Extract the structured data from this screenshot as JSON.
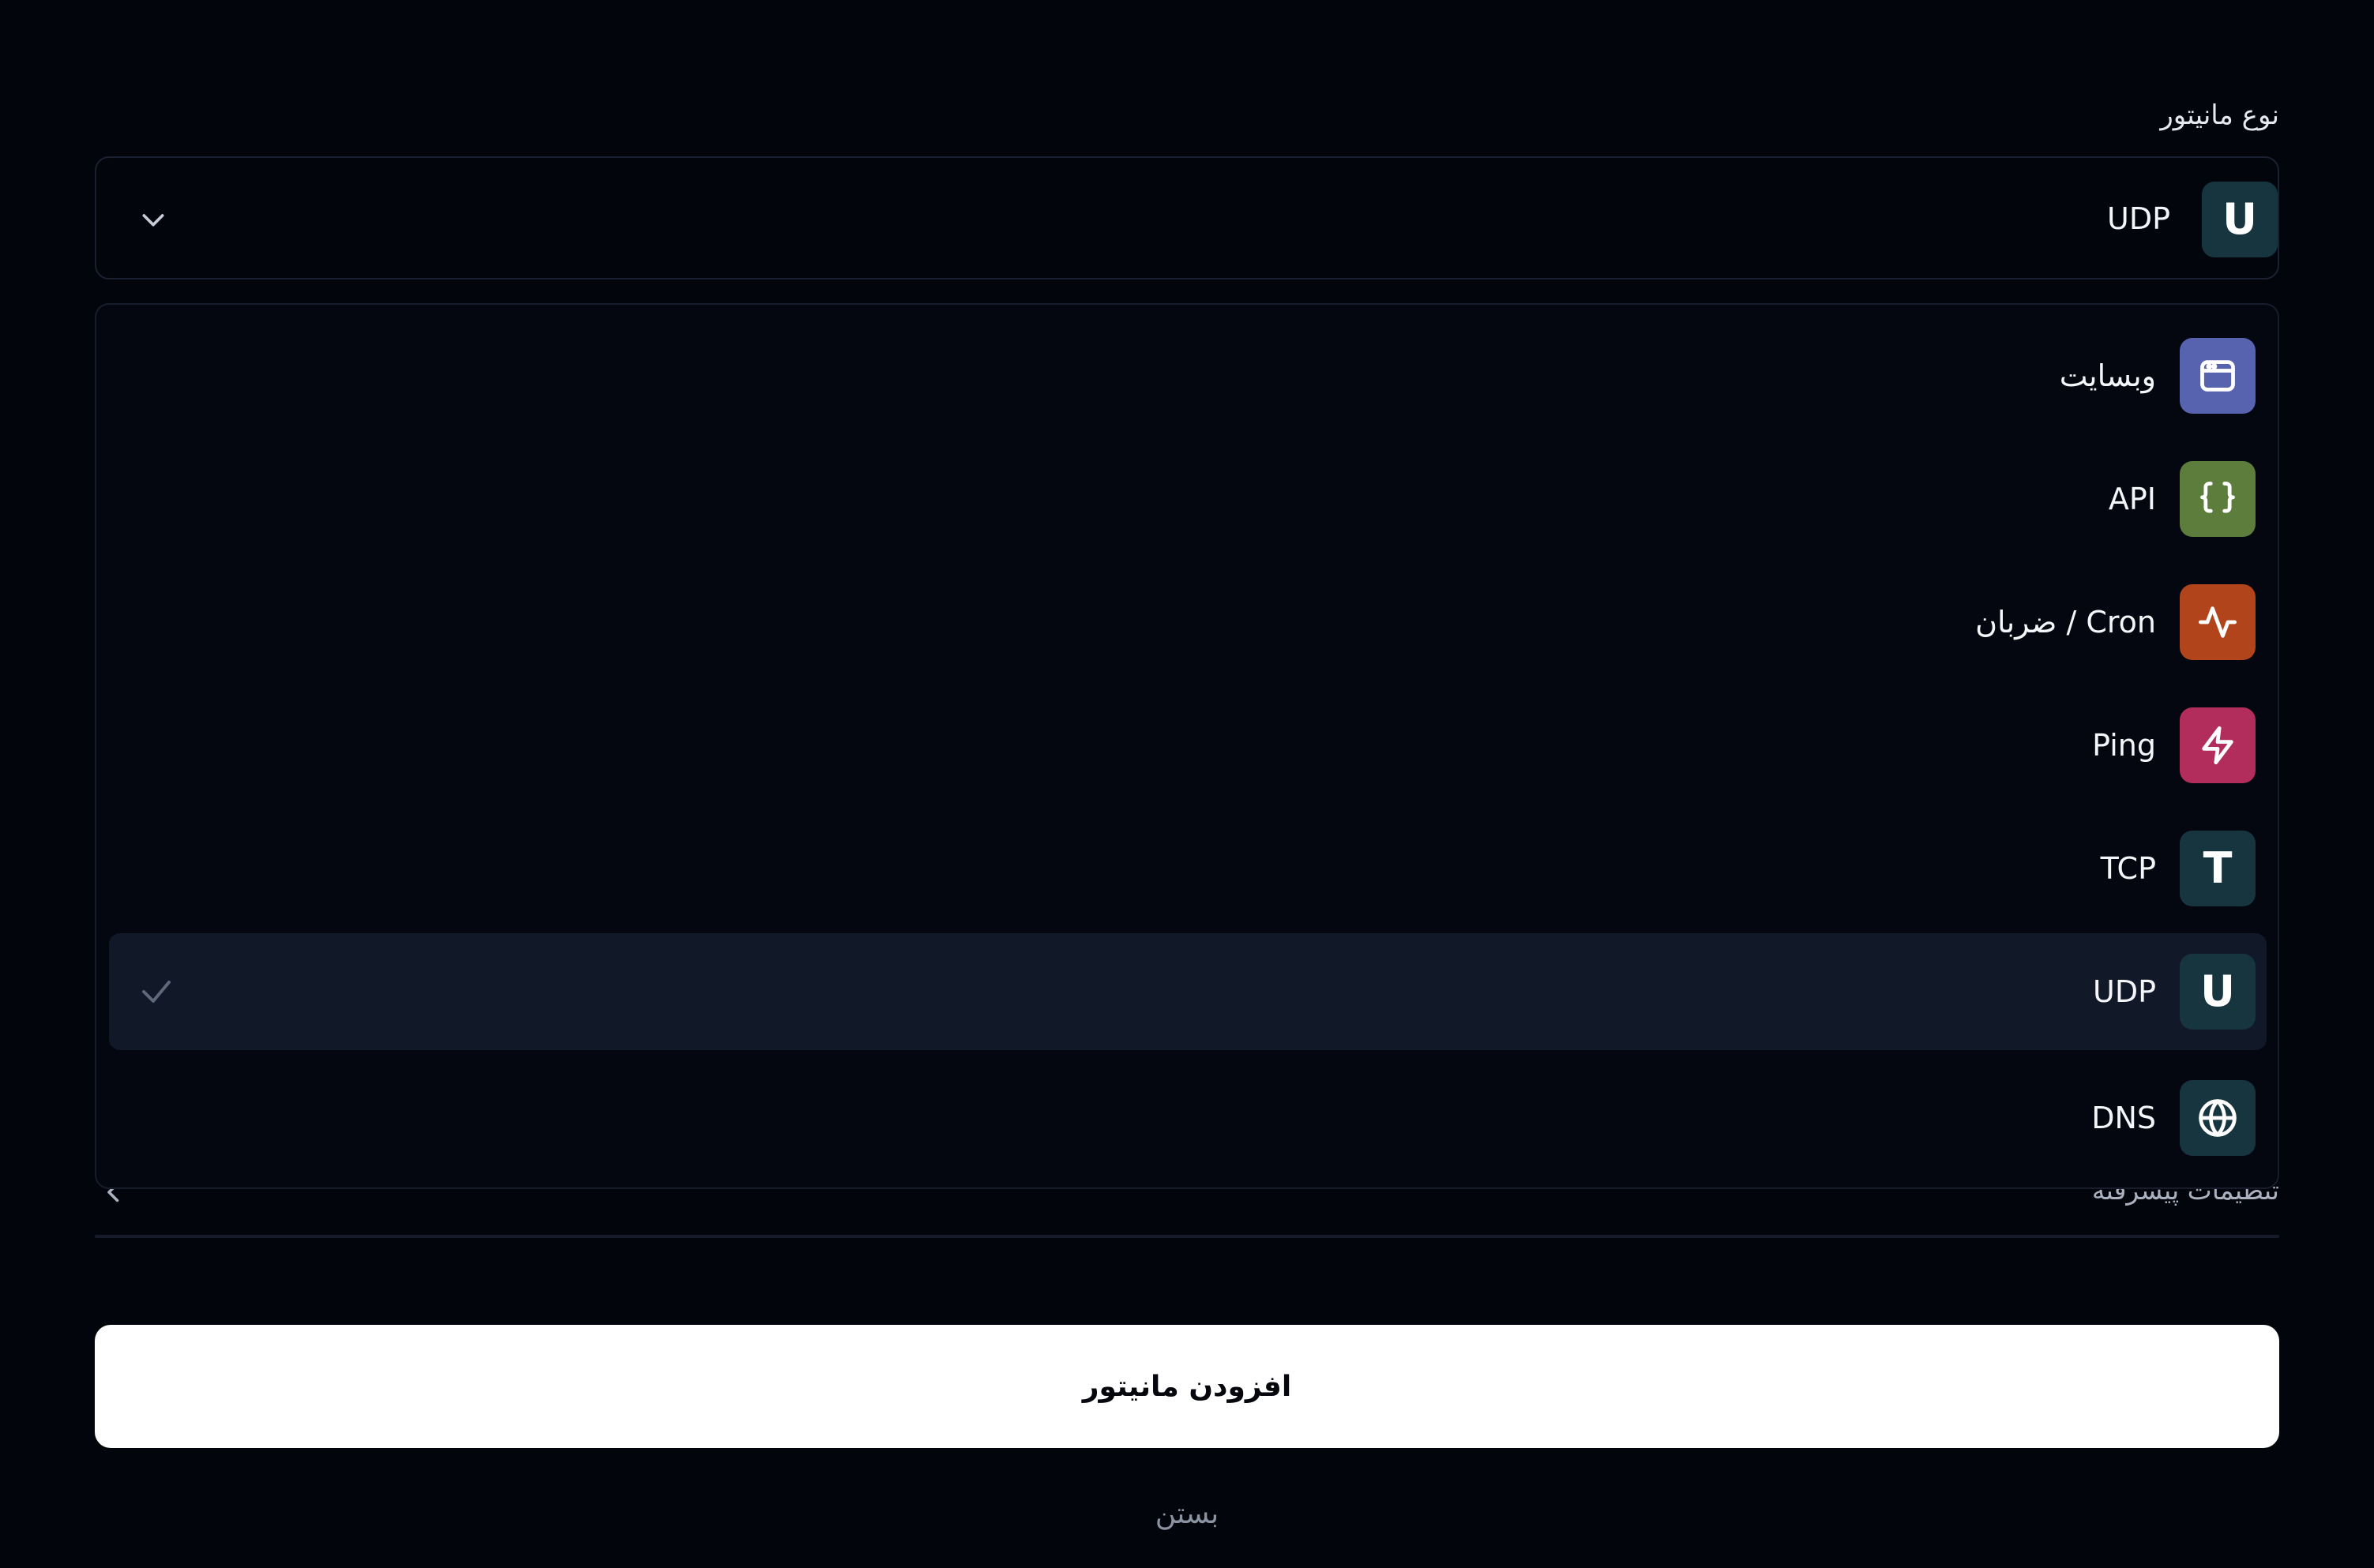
{
  "form": {
    "monitor_type_label": "نوع مانیتور",
    "selected_value": "UDP",
    "selected_icon_letter": "U",
    "advanced_settings_label": "تنظیمات پیشرفته",
    "submit_label": "افزودن مانیتور",
    "close_label": "بستن"
  },
  "dropdown": {
    "options": [
      {
        "label": "وبسایت",
        "icon": "browser-window-icon",
        "color": "#5863b0"
      },
      {
        "label": "API",
        "icon": "curly-braces-icon",
        "color": "#5d7d3d"
      },
      {
        "label": "Cron / ضربان",
        "icon": "activity-pulse-icon",
        "color": "#b2441b"
      },
      {
        "label": "Ping",
        "icon": "lightning-bolt-icon",
        "color": "#b22d5c"
      },
      {
        "label": "TCP",
        "icon": "letter-t-icon",
        "icon_text": "T",
        "color": "#16353f"
      },
      {
        "label": "UDP",
        "icon": "letter-u-icon",
        "icon_text": "U",
        "color": "#16353f",
        "selected": true
      },
      {
        "label": "DNS",
        "icon": "globe-icon",
        "color": "#16353f"
      }
    ]
  },
  "colors": {
    "background": "#03050d",
    "panel": "#040710",
    "selected_option": "#111827",
    "border": "#1b2131",
    "primary_button": "#ffffff"
  }
}
